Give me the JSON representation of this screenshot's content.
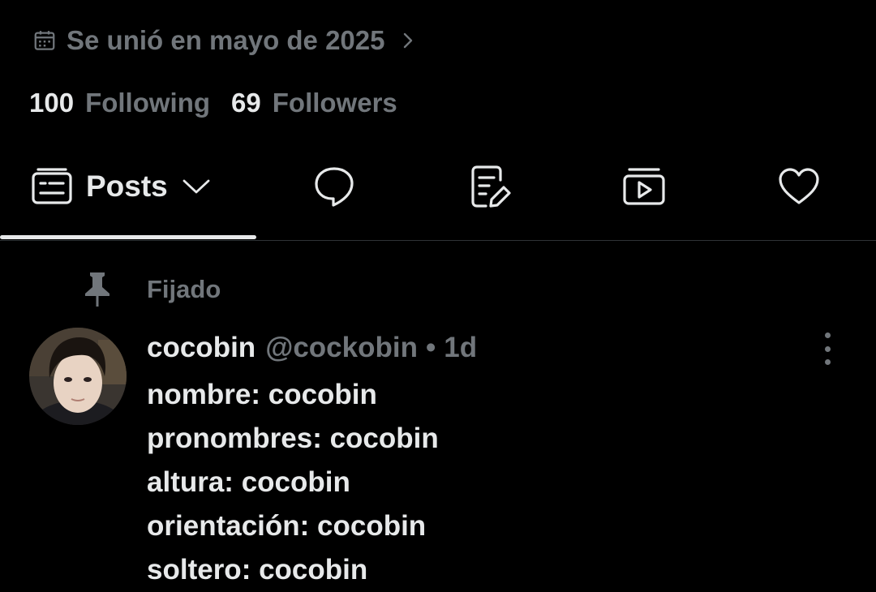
{
  "profile": {
    "joined": "Se unió en mayo de 2025",
    "following_count": "100",
    "following_label": "Following",
    "followers_count": "69",
    "followers_label": "Followers"
  },
  "tabs": {
    "active_label": "Posts",
    "icons": [
      "posts-icon",
      "replies-icon",
      "articles-icon",
      "media-icon",
      "likes-icon"
    ]
  },
  "pinned": {
    "label": "Fijado"
  },
  "post": {
    "name": "cocobin",
    "handle": "@cockobin",
    "separator": "•",
    "time": "1d",
    "lines": [
      "nombre: cocobin",
      "pronombres: cocobin",
      "altura: cocobin",
      "orientación: cocobin",
      "soltero: cocobin"
    ]
  },
  "colors": {
    "background": "#000000",
    "text_primary": "#e7e9ea",
    "text_secondary": "#71767b",
    "divider": "#2f3336"
  }
}
